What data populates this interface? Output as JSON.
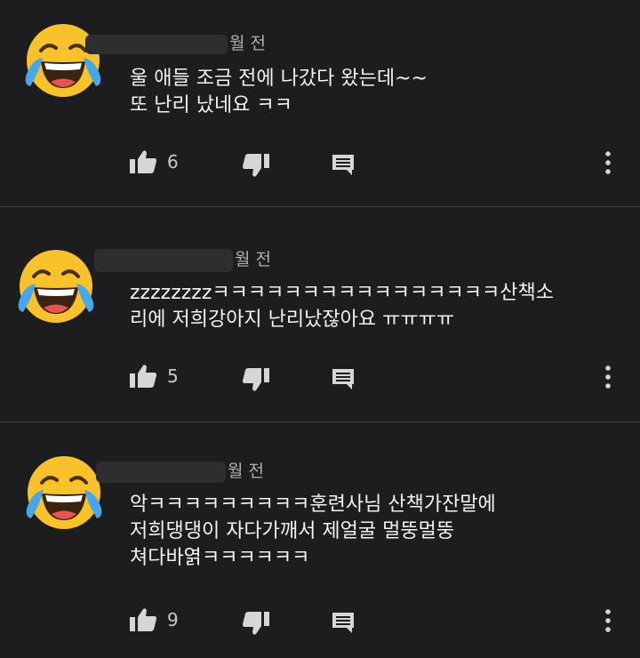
{
  "comments": [
    {
      "time": "월 전",
      "lines": [
        "울 애들 조금 전에 나갔다 왔는데~~",
        "또 난리 났네요 ㅋㅋ"
      ],
      "likes": "6"
    },
    {
      "time": "월 전",
      "lines": [
        "zzzzzzzzㅋㅋㅋㅋㅋㅋㅋㅋㅋㅋㅋㅋㅋㅋㅋㅋ산책소",
        "리에 저희강아지 난리났잖아요 ㅠㅠㅠㅠ"
      ],
      "likes": "5"
    },
    {
      "time": "월 전",
      "lines": [
        "악ㅋㅋㅋㅋㅋㅋㅋㅋㅋ훈련사님 산책가잔말에",
        "저희댕댕이 자다가깨서 제얼굴 멀뚱멀뚱",
        "쳐다바엵ㅋㅋㅋㅋㅋㅋ"
      ],
      "likes": "9"
    }
  ],
  "icons": {
    "avatar": "face-with-tears-of-joy-icon",
    "like": "thumbs-up-icon",
    "dislike": "thumbs-down-icon",
    "reply": "reply-icon",
    "more": "more-vert-icon"
  },
  "colors": {
    "background": "#1d1d1f",
    "text": "#f2f2f2",
    "muted": "#b0b0b0",
    "divider": "#3b3b3b"
  }
}
